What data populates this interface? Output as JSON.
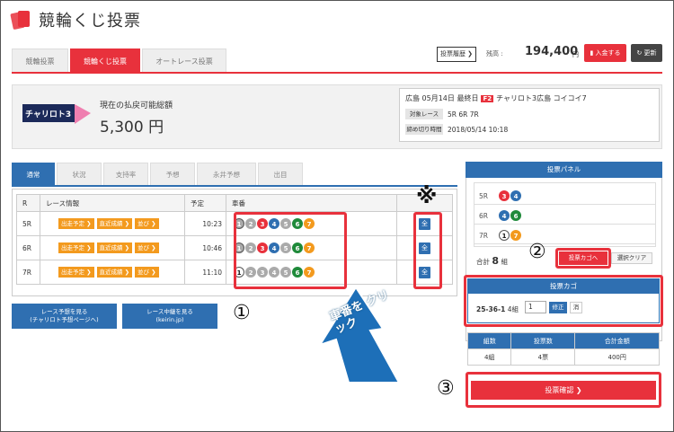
{
  "header": {
    "title": "競輪くじ投票"
  },
  "top_tabs": [
    "競輪投票",
    "競輪くじ投票",
    "オートレース投票"
  ],
  "account": {
    "history_label": "投票履歴 ❯",
    "balance_label": "残高 :",
    "balance": "194,400",
    "unit": "円",
    "deposit_label": "入金する",
    "refresh_label": "更新"
  },
  "carryover": {
    "logo_text": "チャリロト3",
    "label": "現在の払戻可能総額",
    "amount": "5,300 円"
  },
  "detail": {
    "title_prefix": "広島 05月14日 最終日",
    "grade": "F2",
    "title_suffix": "チャリロト3広島 コイコイ7",
    "target_label": "対象レース",
    "target_value": "5R 6R 7R",
    "deadline_label": "締め切り時間",
    "deadline_value": "2018/05/14 10:18"
  },
  "sub_tabs": [
    "通常",
    "状況",
    "支持率",
    "予想",
    "永井予想",
    "出目"
  ],
  "race_table": {
    "headers": [
      "R",
      "レース情報",
      "予定",
      "車番",
      ""
    ],
    "info_buttons": [
      "出走予定 ❯",
      "直近成績 ❯",
      "並び ❯"
    ],
    "vote_icon": "全",
    "rows": [
      {
        "race": "5R",
        "time": "10:23",
        "bikes": [
          "1",
          "2",
          "3",
          "4",
          "5",
          "6",
          "7"
        ]
      },
      {
        "race": "6R",
        "time": "10:46",
        "bikes": [
          "1",
          "2",
          "3",
          "4",
          "5",
          "6",
          "7"
        ]
      },
      {
        "race": "7R",
        "time": "11:10",
        "bikes": [
          "1",
          "2",
          "3",
          "4",
          "5",
          "6",
          "7"
        ]
      }
    ]
  },
  "links": [
    {
      "line1": "レース予想を見る",
      "line2": "(チャリロト予想ページへ)"
    },
    {
      "line1": "レース中継を見る",
      "line2": "(keirin.jp)"
    }
  ],
  "annotations": {
    "n1": "①",
    "n2": "②",
    "n3": "③",
    "asterisk": "※",
    "arrow_text": "車番を クリック"
  },
  "panel": {
    "title": "投票パネル",
    "rows": [
      {
        "race": "5R",
        "picks": [
          "3",
          "4"
        ]
      },
      {
        "race": "6R",
        "picks": [
          "4",
          "6"
        ]
      },
      {
        "race": "7R",
        "picks": [
          "1",
          "7"
        ]
      }
    ],
    "total_label": "合計",
    "total_value": "8",
    "total_unit": "組",
    "cart_button": "投票カゴへ",
    "clear_button": "選択クリア"
  },
  "cart": {
    "title": "投票カゴ",
    "combo": "25-36-1",
    "count": "4組",
    "qty": "1",
    "modify": "修正",
    "delete": "消"
  },
  "summary": {
    "headers": [
      "組数",
      "投票数",
      "合計金額"
    ],
    "values": [
      "4組",
      "4票",
      "400円"
    ]
  },
  "confirm_label": "投票確認 ❯",
  "colors": {
    "accent": "#e8313c",
    "blue": "#2f6fb1",
    "orange": "#f39a1e"
  }
}
